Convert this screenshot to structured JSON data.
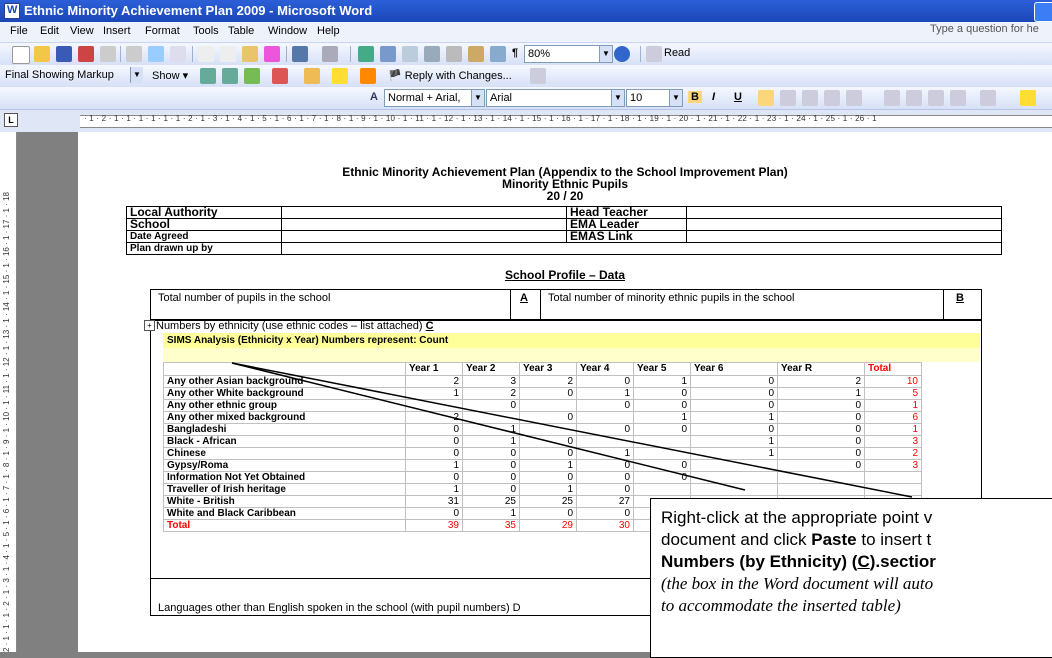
{
  "window": {
    "title": "Ethnic Minority Achievement Plan  2009  - Microsoft Word"
  },
  "menu": {
    "items": [
      "File",
      "Edit",
      "View",
      "Insert",
      "Format",
      "Tools",
      "Table",
      "Window",
      "Help"
    ],
    "ask_placeholder": "Type a question for he"
  },
  "toolbar": {
    "zoom": "80%",
    "read": "Read"
  },
  "reviewing": {
    "markup": "Final Showing Markup",
    "show": "Show",
    "reply": "Reply with Changes..."
  },
  "formatting": {
    "style": "Normal + Arial,",
    "font": "Arial",
    "size": "10",
    "bold": "B",
    "italic": "I",
    "underline": "U"
  },
  "ruler": {
    "h_ticks": "· 1 · 2 · 1 · 1 · 1 · 1 · 1 · 1 · 2 · 1 · 3 · 1 · 4 · 1 · 5 · 1 · 6 · 1 · 7 · 1 · 8 · 1 · 9 · 1 · 10 · 1 · 11 · 1 · 12 · 1 · 13 · 1 · 14 · 1 · 15 · 1 · 16 · 1 · 17 · 1 · 18 · 1 · 19 · 1 · 20 · 1 · 21 · 1 · 22 · 1 · 23 · 1 · 24 · 1 · 25 · 1 · 26 · 1",
    "v_ticks": "2 · 1 · 1 · 1 · 2 · 1 · 3 · 1 · 4 · 1 · 5 · 1 · 6 · 1 · 7 · 1 · 8 · 1 · 9 · 1 · 10 · 1 · 11 · 1 · 12 · 1 · 13 · 1 · 14 · 1 · 15 · 1 · 16 · 1 · 17 · 1 · 18"
  },
  "document": {
    "title_line1": "Ethnic Minority Achievement Plan (Appendix to the School Improvement Plan)",
    "title_line2": "Minority Ethnic Pupils",
    "title_line3": "20   / 20",
    "header_rows": [
      {
        "left": "Local Authority",
        "right": "Head Teacher"
      },
      {
        "left": "School",
        "right": "EMA Leader"
      },
      {
        "left": "Date Agreed",
        "right": "EMAS Link"
      },
      {
        "left": "Plan drawn up by",
        "right": ""
      }
    ],
    "profile_heading": "School Profile – Data",
    "total_pupils": "Total number of pupils in the school",
    "box_a": "A",
    "total_minority": "Total number of minority ethnic pupils in the school",
    "box_b": "B",
    "numbers_by_ethnicity": "Numbers by ethnicity (use ethnic codes – list attached)",
    "box_c": "C",
    "languages": "Languages other than English spoken in the school (with pupil numbers) D"
  },
  "sims": {
    "title": "SIMS Analysis (Ethnicity x Year)  Numbers represent: Count",
    "headers": [
      "",
      "Year  1",
      "Year  2",
      "Year  3",
      "Year  4",
      "Year  5",
      "Year  6",
      "Year  R",
      "Total"
    ],
    "rows": [
      {
        "label": "Any other Asian background",
        "values": [
          "2",
          "3",
          "2",
          "0",
          "1",
          "0",
          "2",
          "10"
        ]
      },
      {
        "label": "Any other White background",
        "values": [
          "1",
          "2",
          "0",
          "1",
          "0",
          "0",
          "1",
          "5"
        ]
      },
      {
        "label": "Any other ethnic group",
        "values": [
          "",
          "0",
          "",
          "0",
          "0",
          "0",
          "0",
          "1"
        ]
      },
      {
        "label": "Any other mixed background",
        "values": [
          "2",
          "",
          "0",
          "",
          "1",
          "1",
          "0",
          "6"
        ]
      },
      {
        "label": "Bangladeshi",
        "values": [
          "0",
          "1",
          "",
          "0",
          "0",
          "0",
          "0",
          "1"
        ]
      },
      {
        "label": "Black - African",
        "values": [
          "0",
          "1",
          "0",
          "",
          "",
          "1",
          "0",
          "3"
        ]
      },
      {
        "label": "Chinese",
        "values": [
          "0",
          "0",
          "0",
          "1",
          "",
          "1",
          "0",
          "2"
        ]
      },
      {
        "label": "Gypsy/Roma",
        "values": [
          "1",
          "0",
          "1",
          "0",
          "0",
          "",
          "0",
          "3"
        ]
      },
      {
        "label": "Information Not Yet Obtained",
        "values": [
          "0",
          "0",
          "0",
          "0",
          "0",
          "",
          "",
          ""
        ]
      },
      {
        "label": "Traveller of Irish heritage",
        "values": [
          "1",
          "0",
          "1",
          "0",
          "",
          "",
          "",
          ""
        ]
      },
      {
        "label": "White - British",
        "values": [
          "31",
          "25",
          "25",
          "27",
          "",
          "",
          "",
          ""
        ]
      },
      {
        "label": "White and Black Caribbean",
        "values": [
          "0",
          "1",
          "0",
          "0",
          "",
          "",
          "",
          ""
        ]
      },
      {
        "label": "Total",
        "values": [
          "39",
          "35",
          "29",
          "30",
          "",
          "",
          "",
          ""
        ]
      }
    ]
  },
  "callout": {
    "line1": "Right-click at the appropriate point v",
    "line2_a": "document and click ",
    "line2_b": "Paste",
    "line2_c": " to insert t",
    "line3_a": "Numbers (by Ethnicity) (",
    "line3_b": "C",
    "line3_c": ").sectior",
    "line4": "(the box in the Word document will auto",
    "line5": "to accommodate the inserted table)"
  }
}
